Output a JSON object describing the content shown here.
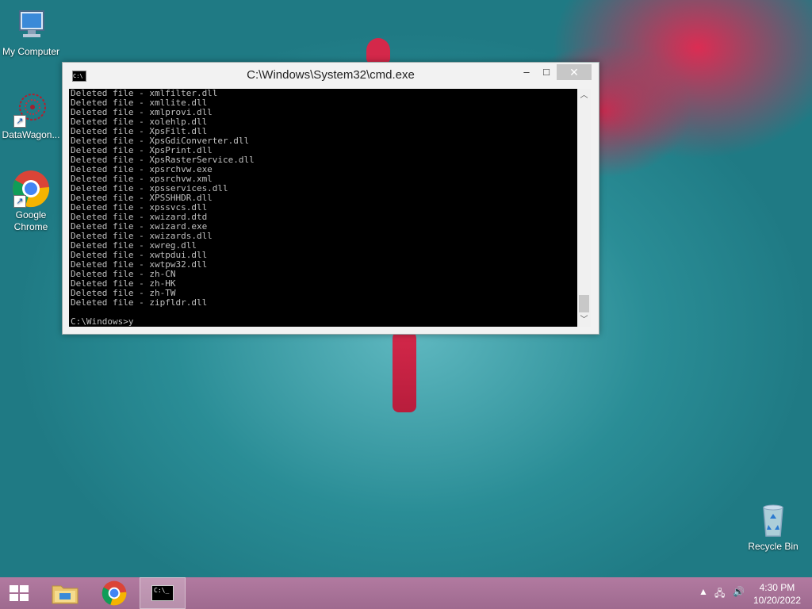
{
  "desktop": {
    "icons": [
      {
        "label": "My Computer"
      },
      {
        "label": "DataWagon..."
      },
      {
        "label": "Google Chrome"
      },
      {
        "label": "Recycle Bin"
      }
    ]
  },
  "cmd_window": {
    "title": "C:\\Windows\\System32\\cmd.exe",
    "minimize": "‒",
    "maximize": "□",
    "close": "✕",
    "lines": [
      "Deleted file - xmlfilter.dll",
      "Deleted file - xmllite.dll",
      "Deleted file - xmlprovi.dll",
      "Deleted file - xolehlp.dll",
      "Deleted file - XpsFilt.dll",
      "Deleted file - XpsGdiConverter.dll",
      "Deleted file - XpsPrint.dll",
      "Deleted file - XpsRasterService.dll",
      "Deleted file - xpsrchvw.exe",
      "Deleted file - xpsrchvw.xml",
      "Deleted file - xpsservices.dll",
      "Deleted file - XPSSHHDR.dll",
      "Deleted file - xpssvcs.dll",
      "Deleted file - xwizard.dtd",
      "Deleted file - xwizard.exe",
      "Deleted file - xwizards.dll",
      "Deleted file - xwreg.dll",
      "Deleted file - xwtpdui.dll",
      "Deleted file - xwtpw32.dll",
      "Deleted file - zh-CN",
      "Deleted file - zh-HK",
      "Deleted file - zh-TW",
      "Deleted file - zipfldr.dll"
    ],
    "prompt": "C:\\Windows>y"
  },
  "taskbar": {
    "cmd_icon_text": "C:\\_",
    "time": "4:30 PM",
    "date": "10/20/2022"
  }
}
